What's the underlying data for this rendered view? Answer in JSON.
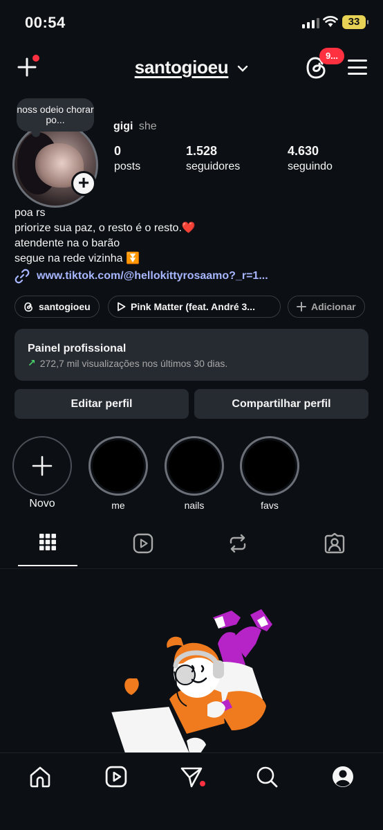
{
  "status_bar": {
    "time": "00:54",
    "battery": "33"
  },
  "header": {
    "username": "santogioeu",
    "threads_badge": "9..."
  },
  "profile": {
    "note": "noss odeio chorar po...",
    "display_name": "gigi",
    "pronouns": "she",
    "stats": [
      {
        "value": "0",
        "label": "posts"
      },
      {
        "value": "1.528",
        "label": "seguidores"
      },
      {
        "value": "4.630",
        "label": "seguindo"
      }
    ],
    "bio": [
      "poa rs",
      "priorize sua paz, o resto é o resto.❤️",
      "atendente na o barão",
      "segue na rede vizinha ⏬"
    ],
    "link": "www.tiktok.com/@hellokittyrosaamo?_r=1..."
  },
  "chips": {
    "threads": "santogioeu",
    "music": "Pink Matter (feat. André 3...",
    "add": "Adicionar"
  },
  "panel": {
    "title": "Painel profissional",
    "subtitle": "272,7 mil visualizações nos últimos 30 dias."
  },
  "buttons": {
    "edit": "Editar perfil",
    "share": "Compartilhar perfil"
  },
  "highlights": [
    {
      "label": "Novo"
    },
    {
      "label": "me"
    },
    {
      "label": "nails"
    },
    {
      "label": "favs"
    }
  ],
  "colors": {
    "background": "#0c1014",
    "surface": "#262a31",
    "badge": "#ff3040",
    "link": "#a7b6ff",
    "trend": "#4ad36b"
  }
}
